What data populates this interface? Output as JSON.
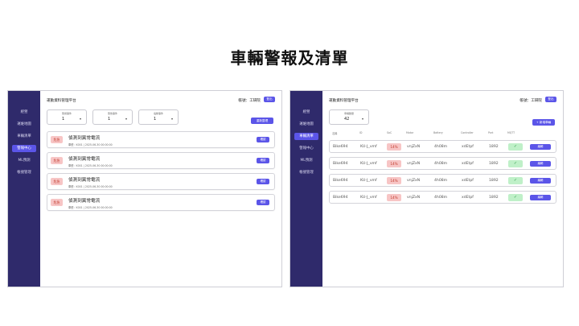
{
  "slide": {
    "title": "車輛警報及清單"
  },
  "app": {
    "title": "運動資料管理平台",
    "account": "帳號：工研院",
    "logout": "登出"
  },
  "sidebar": {
    "items": [
      "經營",
      "運維地圖",
      "車輛清單",
      "警報中心",
      "ML預測",
      "帳號管理"
    ]
  },
  "left_panel": {
    "active_index": 3,
    "filters": [
      {
        "label": "警報事件",
        "value": "1",
        "caret": "▾"
      },
      {
        "label": "警告事件",
        "value": "1",
        "caret": "▾"
      },
      {
        "label": "電壓事件",
        "value": "1",
        "caret": "▾"
      }
    ],
    "reset_label": "重新整理",
    "alerts": [
      {
        "badge": "危急",
        "title": "偵測到異常電流",
        "meta": "車號：K001 | 2025-06-30 00:00:00",
        "action": "確認"
      },
      {
        "badge": "危急",
        "title": "偵測到異常電流",
        "meta": "車號：K001 | 2025-06-30 00:00:00",
        "action": "確認"
      },
      {
        "badge": "危急",
        "title": "偵測到異常電流",
        "meta": "車號：K001 | 2025-06-30 00:00:00",
        "action": "確認"
      },
      {
        "badge": "危急",
        "title": "偵測到異常電流",
        "meta": "車號：K001 | 2025-06-30 00:00:00",
        "action": "確認"
      }
    ]
  },
  "right_panel": {
    "active_index": 2,
    "filter": {
      "label": "車輛數量",
      "value": "42",
      "caret": "▾"
    },
    "add_label": "+ 新增車輛",
    "columns": [
      "名稱",
      "ID",
      "SoC",
      "Motor",
      "Battery",
      "Controller",
      "Port",
      "MQTT"
    ],
    "rows": [
      {
        "name": "Bike694",
        "id": "KU-J_vmf",
        "soc": "14%",
        "motor": "vnjZxN",
        "battery": "4h08m",
        "controller": "xdEtpf",
        "port": "1892",
        "mqtt": "✓",
        "action": "編輯"
      },
      {
        "name": "Bike694",
        "id": "KU-J_vmf",
        "soc": "14%",
        "motor": "vnjZxN",
        "battery": "4h08m",
        "controller": "xdEtpf",
        "port": "1892",
        "mqtt": "✓",
        "action": "編輯"
      },
      {
        "name": "Bike694",
        "id": "KU-J_vmf",
        "soc": "14%",
        "motor": "vnjZxN",
        "battery": "4h08m",
        "controller": "xdEtpf",
        "port": "1892",
        "mqtt": "✓",
        "action": "編輯"
      },
      {
        "name": "Bike694",
        "id": "KU-J_vmf",
        "soc": "14%",
        "motor": "vnjZxN",
        "battery": "4h08m",
        "controller": "xdEtpf",
        "port": "1892",
        "mqtt": "✓",
        "action": "編輯"
      }
    ]
  },
  "colors": {
    "sidebar": "#2f2a6b",
    "accent": "#5b55e8",
    "danger_bg": "#f7c5c5",
    "danger_text": "#c0392b",
    "ok_bg": "#bff0c8",
    "ok_text": "#2e9e4a"
  }
}
